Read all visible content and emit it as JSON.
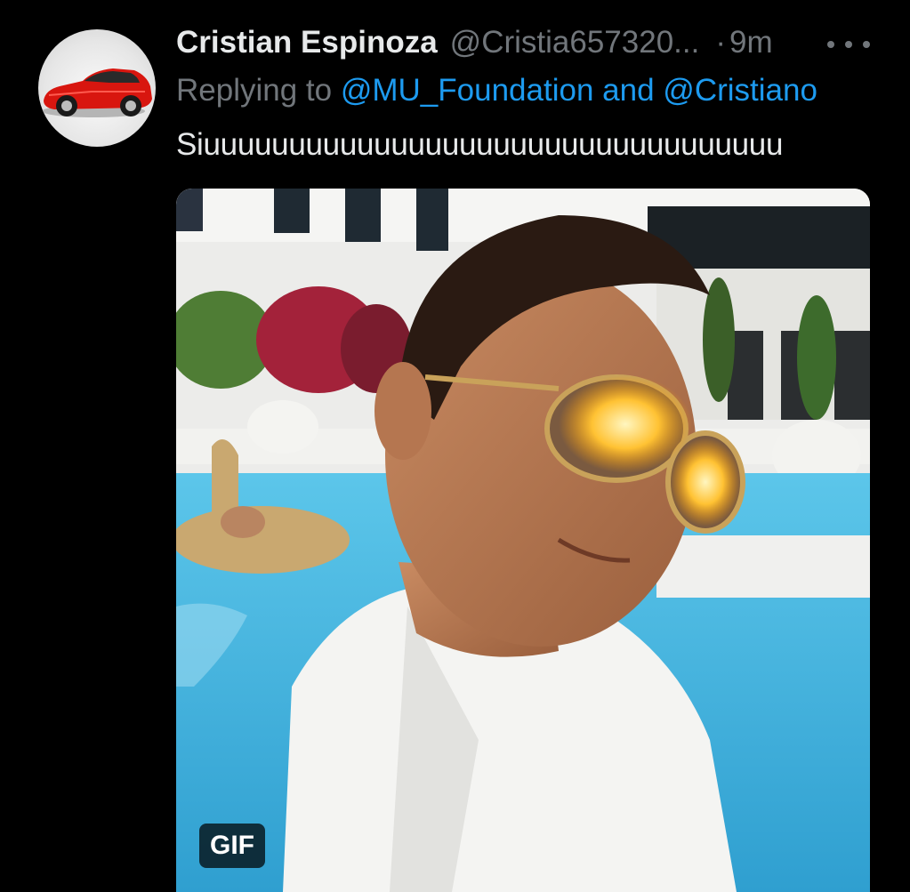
{
  "tweet": {
    "display_name": "Cristian Espinoza",
    "handle": "@Cristia657320...",
    "separator": "·",
    "time": "9m",
    "replying_prefix": "Replying to",
    "mention_1": "@MU_Foundation",
    "and_word": "and",
    "mention_2": "@Cristiano",
    "text": "Siuuuuuuuuuuuuuuuuuuuuuuuuuuuuuuuuuu",
    "media_badge": "GIF"
  },
  "icons": {
    "more": "more-horizontal-icon",
    "avatar": "red-sports-car-avatar"
  },
  "colors": {
    "background": "#000000",
    "primary_text": "#e7e9ea",
    "secondary_text": "#71767b",
    "link": "#1d9bf0",
    "pool_water": "#3fb2dc"
  }
}
